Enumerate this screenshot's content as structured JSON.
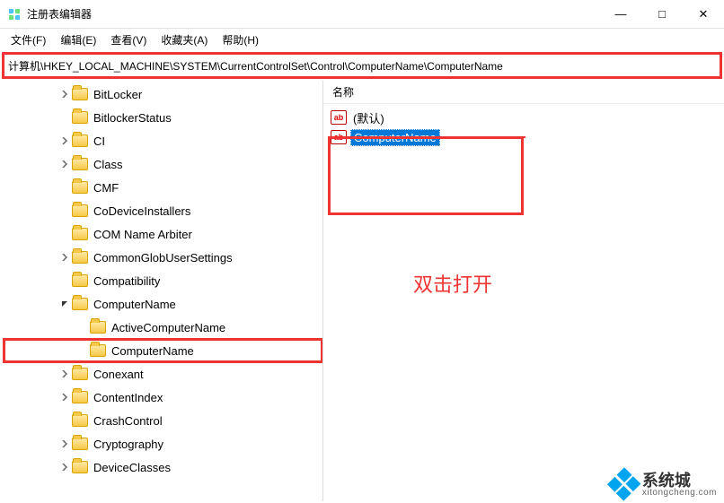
{
  "window": {
    "title": "注册表编辑器",
    "minimize": "—",
    "maximize": "□",
    "close": "✕"
  },
  "menu": {
    "file": "文件(F)",
    "edit": "编辑(E)",
    "view": "查看(V)",
    "favorites": "收藏夹(A)",
    "help": "帮助(H)"
  },
  "address": {
    "path": "计算机\\HKEY_LOCAL_MACHINE\\SYSTEM\\CurrentControlSet\\Control\\ComputerName\\ComputerName"
  },
  "tree": [
    {
      "label": "BitLocker",
      "chevron": ">",
      "depth": 3
    },
    {
      "label": "BitlockerStatus",
      "chevron": "",
      "depth": 3
    },
    {
      "label": "CI",
      "chevron": ">",
      "depth": 3
    },
    {
      "label": "Class",
      "chevron": ">",
      "depth": 3
    },
    {
      "label": "CMF",
      "chevron": "",
      "depth": 3
    },
    {
      "label": "CoDeviceInstallers",
      "chevron": "",
      "depth": 3
    },
    {
      "label": "COM Name Arbiter",
      "chevron": "",
      "depth": 3
    },
    {
      "label": "CommonGlobUserSettings",
      "chevron": ">",
      "depth": 3
    },
    {
      "label": "Compatibility",
      "chevron": "",
      "depth": 3
    },
    {
      "label": "ComputerName",
      "chevron": "v",
      "depth": 3
    },
    {
      "label": "ActiveComputerName",
      "chevron": "",
      "depth": 4
    },
    {
      "label": "ComputerName",
      "chevron": "",
      "depth": 4,
      "highlight": true
    },
    {
      "label": "Conexant",
      "chevron": ">",
      "depth": 3
    },
    {
      "label": "ContentIndex",
      "chevron": ">",
      "depth": 3
    },
    {
      "label": "CrashControl",
      "chevron": "",
      "depth": 3
    },
    {
      "label": "Cryptography",
      "chevron": ">",
      "depth": 3
    },
    {
      "label": "DeviceClasses",
      "chevron": ">",
      "depth": 3
    }
  ],
  "list": {
    "col_name": "名称",
    "rows": [
      {
        "name": "(默认)",
        "selected": false
      },
      {
        "name": "ComputerName",
        "selected": true
      }
    ]
  },
  "annotation": {
    "text": "双击打开"
  },
  "watermark": {
    "cn": "系统城",
    "en": "xitongcheng.com"
  },
  "colors": {
    "highlight_red": "#e33",
    "selection_blue": "#0078d7"
  }
}
